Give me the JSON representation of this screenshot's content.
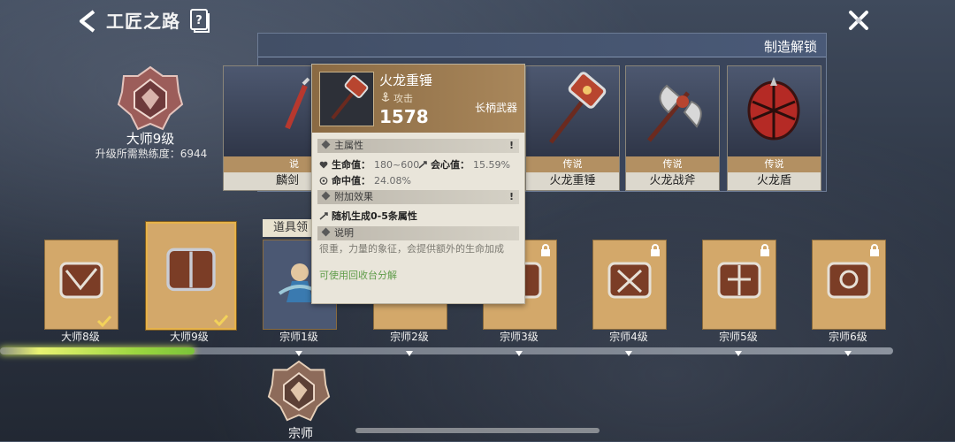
{
  "header": {
    "title": "工匠之路",
    "back_icon": "chevron-left-icon",
    "help_icon": "book-question-icon",
    "close_icon": "close-x-icon"
  },
  "current_rank": {
    "name": "大师9级",
    "requirement": "升级所需熟练度：6944"
  },
  "unlock_panel": {
    "title": "制造解锁",
    "items": [
      {
        "grade": "说",
        "name": "麟剑"
      },
      {
        "grade": "传说",
        "name": "火龙重锤"
      },
      {
        "grade": "传说",
        "name": "火龙战斧"
      },
      {
        "grade": "传说",
        "name": "火龙盾"
      }
    ]
  },
  "tooltip": {
    "name": "火龙重锤",
    "type": "攻击",
    "score": "1578",
    "category": "长柄武器",
    "main_attr_title": "主属性",
    "hp_label": "生命值：",
    "hp_value": "180~600",
    "crit_label": "会心值：",
    "crit_value": "15.59%",
    "hit_label": "命中值：",
    "hit_value": "24.08%",
    "extra_title": "附加效果",
    "extra_text": "随机生成0-5条属性",
    "desc_title": "说明",
    "desc_text": "很重，力量的象征，会提供额外的生命加成",
    "hint": "可使用回收台分解"
  },
  "tab_tag": "道具领",
  "levels": [
    {
      "label": "大师8级",
      "locked": false,
      "claimed": true
    },
    {
      "label": "大师9级",
      "locked": false,
      "claimed": true,
      "selected": true
    },
    {
      "label": "宗师1级",
      "locked": false,
      "claimed": false
    },
    {
      "label": "宗师2级",
      "locked": false,
      "claimed": false
    },
    {
      "label": "宗师3级",
      "locked": true,
      "claimed": false
    },
    {
      "label": "宗师4级",
      "locked": true,
      "claimed": false
    },
    {
      "label": "宗师5级",
      "locked": true,
      "claimed": false
    },
    {
      "label": "宗师6级",
      "locked": true,
      "claimed": false
    }
  ],
  "next_rank": {
    "name": "宗师"
  },
  "colors": {
    "accent_gold": "#e6b24a",
    "progress_green": "#9bd640",
    "card_bg": "#d3a86a"
  }
}
